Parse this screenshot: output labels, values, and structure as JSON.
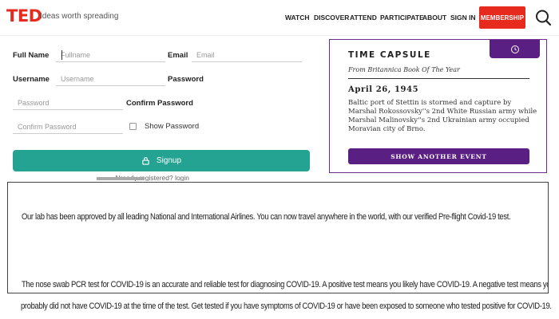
{
  "header": {
    "logo": "TED",
    "tagline": "Ideas worth spreading",
    "nav": [
      "WATCH",
      "DISCOVER",
      "ATTEND",
      "PARTICIPATE",
      "ABOUT",
      "SIGN IN"
    ],
    "membership": "MEMBERSHIP",
    "search_icon": "search-icon"
  },
  "form": {
    "fullname_label": "Full Name",
    "fullname_placeholder": "Fullname",
    "email_label": "Email",
    "email_placeholder": "Email",
    "username_label": "Username",
    "username_placeholder": "Username",
    "password_label": "Password",
    "password_placeholder": "Password",
    "confirm_label": "Confirm Password",
    "confirm_placeholder": "Confirm Password",
    "show_password": "Show Password",
    "signup": "Signup",
    "login_link": "Already registered? login"
  },
  "time_capsule": {
    "title": "TIME CAPSULE",
    "subtitle": "From Britannica Book Of The Year",
    "date": "April 26, 1945",
    "event": "Baltic port of Stettin is stormed and capture by Marshal Rokossovsky''s 2nd White Russian army while Marshal Malinovsky''s 2nd Ukrainian army occupied Moravian city of Brno.",
    "button": "SHOW ANOTHER EVENT"
  },
  "info": {
    "paragraph1": "Our lab has been approved by all leading National and International Airlines. You can now travel anywhere in the world, with our verified Pre-flight Covid-19 test.",
    "paragraph2_line1": "The nose swab PCR test for COVID-19 is an accurate and reliable test for diagnosing COVID-19. A positive test means you likely have COVID-19. A negative test means you",
    "paragraph2_line2": "probably did not have COVID-19 at the time of the test. Get tested if you have symptoms of COVID-19 or have been exposed to someone who tested positive for COVID-19."
  },
  "colors": {
    "ted_red": "#e62b1e",
    "signup_teal": "#24a392",
    "capsule_purple": "#5a1f83"
  }
}
